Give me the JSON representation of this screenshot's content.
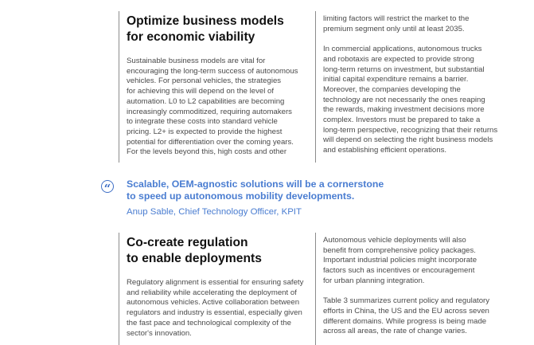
{
  "section1": {
    "heading_lines": [
      "Optimize business models",
      "for economic viability"
    ],
    "left_lines": [
      "Sustainable business models are vital for",
      "encouraging the long-term success of autonomous",
      "vehicles. For personal vehicles, the strategies",
      "for achieving this will depend on the level of",
      "automation. L0 to L2 capabilities are becoming",
      "increasingly commoditized, requiring automakers",
      "to integrate these costs into standard vehicle",
      "pricing. L2+ is expected to provide the highest",
      "potential for differentiation over the coming years.",
      "For the levels beyond this, high costs and other"
    ],
    "right_p1_lines": [
      "limiting factors will restrict the market to the",
      "premium segment only until at least 2035."
    ],
    "right_p2_lines": [
      "In commercial applications, autonomous trucks",
      "and robotaxis are expected to provide strong",
      "long-term returns on investment, but substantial",
      "initial capital expenditure remains a barrier.",
      "Moreover, the companies developing the",
      "technology are not necessarily the ones reaping",
      "the rewards, making investment decisions more",
      "complex. Investors must be prepared to take a",
      "long-term perspective, recognizing that their returns",
      "will depend on selecting the right business models",
      "and establishing efficient operations."
    ]
  },
  "quote": {
    "icon": "quotation-mark-icon",
    "lines": [
      "Scalable, OEM-agnostic solutions will be a cornerstone",
      "to speed up autonomous mobility developments."
    ],
    "attribution": "Anup Sable, Chief Technology Officer, KPIT",
    "color": "#4a7dd1"
  },
  "section2": {
    "heading_lines": [
      "Co-create regulation",
      "to enable deployments"
    ],
    "left_lines": [
      "Regulatory alignment is essential for ensuring safety",
      "and reliability while accelerating the deployment of",
      "autonomous vehicles. Active collaboration between",
      "regulators and industry is essential, especially given",
      "the fast pace and technological complexity of the",
      "sector's innovation."
    ],
    "right_p1_lines": [
      "Autonomous vehicle deployments will also",
      "benefit from comprehensive policy packages.",
      "Important industrial policies might incorporate",
      "factors such as incentives or encouragement",
      "for urban planning integration."
    ],
    "right_p2_lines": [
      "Table 3 summarizes current policy and regulatory",
      "efforts in China, the US and the EU across seven",
      "different domains. While progress is being made",
      "across all areas, the rate of change varies."
    ]
  }
}
